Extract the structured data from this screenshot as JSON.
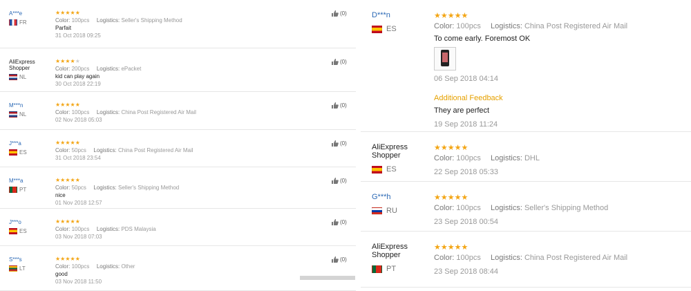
{
  "left_reviews": [
    {
      "name": "A***e",
      "shopper": false,
      "country": "FR",
      "flag": "fr",
      "stars": 5,
      "color_label": "Color:",
      "color": "100pcs",
      "logistics_label": "Logistics:",
      "logistics": "Seller's Shipping Method",
      "text": "Parfait",
      "date": "31 Oct 2018 09:25",
      "likes": "(0)"
    },
    {
      "name": "AliExpress Shopper",
      "shopper": true,
      "country": "NL",
      "flag": "nl",
      "stars": 4,
      "color_label": "Color:",
      "color": "200pcs",
      "logistics_label": "Logistics:",
      "logistics": "ePacket",
      "text": "kid can play again",
      "date": "30 Oct 2018 22:19",
      "likes": "(0)"
    },
    {
      "name": "M***n",
      "shopper": false,
      "country": "NL",
      "flag": "nl",
      "stars": 5,
      "color_label": "Color:",
      "color": "100pcs",
      "logistics_label": "Logistics:",
      "logistics": "China Post Registered Air Mail",
      "text": "",
      "date": "02 Nov 2018 05:03",
      "likes": "(0)"
    },
    {
      "name": "J***a",
      "shopper": false,
      "country": "ES",
      "flag": "es",
      "stars": 5,
      "color_label": "Color:",
      "color": "50pcs",
      "logistics_label": "Logistics:",
      "logistics": "China Post Registered Air Mail",
      "text": "",
      "date": "31 Oct 2018 23:54",
      "likes": "(0)"
    },
    {
      "name": "M***a",
      "shopper": false,
      "country": "PT",
      "flag": "pt",
      "stars": 5,
      "color_label": "Color:",
      "color": "50pcs",
      "logistics_label": "Logistics:",
      "logistics": "Seller's Shipping Method",
      "text": "nice",
      "date": "01 Nov 2018 12:57",
      "likes": "(0)"
    },
    {
      "name": "J***o",
      "shopper": false,
      "country": "ES",
      "flag": "es",
      "stars": 5,
      "color_label": "Color:",
      "color": "100pcs",
      "logistics_label": "Logistics:",
      "logistics": "PDS Malaysia",
      "text": "",
      "date": "03 Nov 2018 07:03",
      "likes": "(0)"
    },
    {
      "name": "S***s",
      "shopper": false,
      "country": "LT",
      "flag": "lt",
      "stars": 5,
      "color_label": "Color:",
      "color": "100pcs",
      "logistics_label": "Logistics:",
      "logistics": "Other",
      "text": "good",
      "date": "03 Nov 2018 11:50",
      "likes": "(0)"
    }
  ],
  "right_reviews": [
    {
      "name": "D***n",
      "shopper": false,
      "country": "ES",
      "flag": "es",
      "stars": 5,
      "color_label": "Color:",
      "color": "100pcs",
      "logistics_label": "Logistics:",
      "logistics": "China Post Registered Air Mail",
      "text": "To come early. Foremost OK",
      "date": "06 Sep 2018 04:14",
      "additional_label": "Additional Feedback",
      "additional_text": "They are perfect",
      "additional_date": "19 Sep 2018 11:24"
    },
    {
      "name": "AliExpress Shopper",
      "shopper": true,
      "country": "ES",
      "flag": "es",
      "stars": 5,
      "color_label": "Color:",
      "color": "100pcs",
      "logistics_label": "Logistics:",
      "logistics": "DHL",
      "text": "",
      "date": "22 Sep 2018 05:33"
    },
    {
      "name": "G***h",
      "shopper": false,
      "country": "RU",
      "flag": "ru",
      "stars": 5,
      "color_label": "Color:",
      "color": "100pcs",
      "logistics_label": "Logistics:",
      "logistics": "Seller's Shipping Method",
      "text": "",
      "date": "23 Sep 2018 00:54"
    },
    {
      "name": "AliExpress Shopper",
      "shopper": true,
      "country": "PT",
      "flag": "pt",
      "stars": 5,
      "color_label": "Color:",
      "color": "100pcs",
      "logistics_label": "Logistics:",
      "logistics": "China Post Registered Air Mail",
      "text": "",
      "date": "23 Sep 2018 08:44"
    }
  ],
  "icons": {
    "like": "thumbs-up-icon",
    "star": "star-icon",
    "photo": "review-photo-thumbnail"
  },
  "colors": {
    "star": "#f3a514",
    "name_link": "#2a68b5",
    "additional_feedback": "#e6a100"
  }
}
